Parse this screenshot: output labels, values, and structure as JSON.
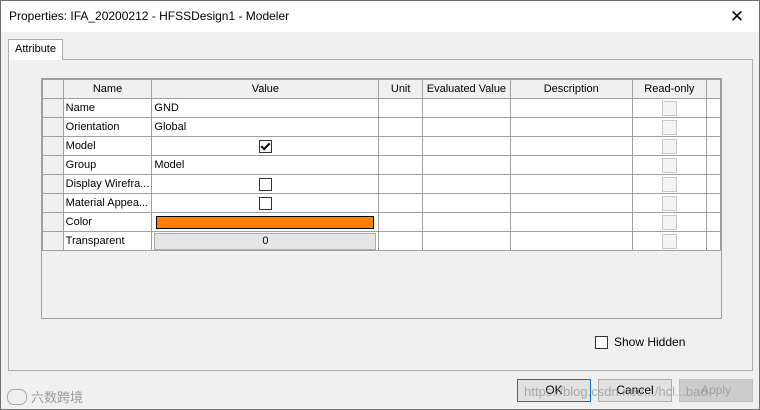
{
  "window": {
    "title": "Properties: IFA_20200212 - HFSSDesign1 - Modeler",
    "close_glyph": "✕"
  },
  "tabs": [
    {
      "label": "Attribute"
    }
  ],
  "grid": {
    "columns": [
      "Name",
      "Value",
      "Unit",
      "Evaluated Value",
      "Description",
      "Read-only"
    ],
    "rows": [
      {
        "name": "Name",
        "value_type": "text",
        "value": "GND",
        "unit": "",
        "evaluated": "",
        "description": "",
        "readonly": false
      },
      {
        "name": "Orientation",
        "value_type": "text",
        "value": "Global",
        "unit": "",
        "evaluated": "",
        "description": "",
        "readonly": false
      },
      {
        "name": "Model",
        "value_type": "checkbox",
        "checked": true,
        "unit": "",
        "evaluated": "",
        "description": "",
        "readonly": false
      },
      {
        "name": "Group",
        "value_type": "text",
        "value": "Model",
        "unit": "",
        "evaluated": "",
        "description": "",
        "readonly": false
      },
      {
        "name": "Display Wirefra...",
        "value_type": "checkbox",
        "checked": false,
        "unit": "",
        "evaluated": "",
        "description": "",
        "readonly": false
      },
      {
        "name": "Material Appea...",
        "value_type": "checkbox",
        "checked": false,
        "unit": "",
        "evaluated": "",
        "description": "",
        "readonly": false
      },
      {
        "name": "Color",
        "value_type": "color",
        "color": "#ff8000",
        "unit": "",
        "evaluated": "",
        "description": "",
        "readonly": false
      },
      {
        "name": "Transparent",
        "value_type": "spin",
        "value": "0",
        "unit": "",
        "evaluated": "",
        "description": "",
        "readonly": false
      }
    ]
  },
  "show_hidden": {
    "label": "Show Hidden",
    "checked": false
  },
  "buttons": {
    "ok": "OK",
    "cancel": "Cancel",
    "apply": "Apply"
  },
  "watermark": {
    "left": "六数跨境",
    "right": "https://blog.csdn.net/.../hcl...bao"
  },
  "colors": {
    "accent": "#0078d7",
    "color_swatch": "#ff8000"
  }
}
